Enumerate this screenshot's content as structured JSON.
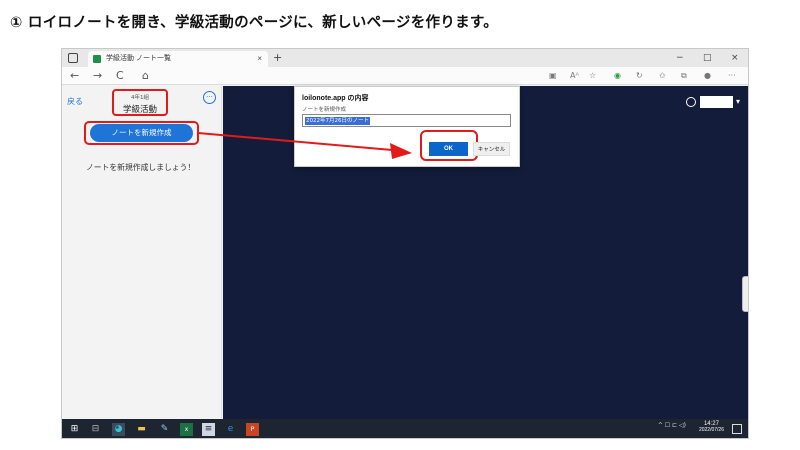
{
  "doc": {
    "heading": "① ロイロノートを開き、学級活動のページに、新しいページを作ります。"
  },
  "browser": {
    "tab_title": "学級活動 ノート一覧",
    "tab_close": "×",
    "new_tab": "+",
    "window_controls": {
      "minimize": "−",
      "restore": "□",
      "close": "×"
    },
    "nav": {
      "back": "←",
      "forward": "→",
      "reload": "C",
      "home": "⌂"
    },
    "toolbar_icons": [
      "read-mode-icon",
      "font-icon",
      "favorite-icon",
      "extension-icon",
      "refresh-icon",
      "favorites-icon",
      "collections-icon",
      "profile-icon",
      "more-icon"
    ]
  },
  "sidebar": {
    "back_label": "戻る",
    "grade": "4年1組",
    "class_name": "学級活動",
    "menu_icon": "more-horizontal-icon",
    "create_button": "ノートを新規作成",
    "empty_message": "ノートを新規作成しましょう！"
  },
  "dialog": {
    "title": "loilonote.app の内容",
    "label": "ノートを新規作成",
    "input_value": "2022年7月26日のノート",
    "ok": "OK",
    "cancel": "キャンセル"
  },
  "taskbar": {
    "icons": [
      "windows-start-icon",
      "task-view-icon",
      "edge-icon",
      "file-explorer-icon",
      "paint-icon",
      "excel-icon",
      "notepad-icon",
      "ie-icon",
      "powerpoint-icon"
    ],
    "tray_text": "^ ☐ ⊏ ◁)",
    "time": "14:27",
    "date": "2022/07/26"
  },
  "colors": {
    "accent": "#1f74d8",
    "highlight": "#e21a1a",
    "content_bg": "#131c3a",
    "taskbar": "#1c2530"
  }
}
